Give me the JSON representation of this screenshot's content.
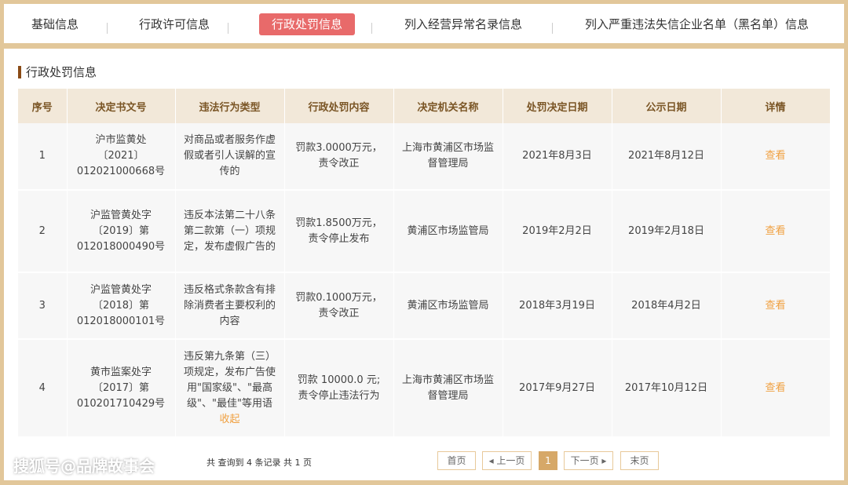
{
  "tabs": [
    {
      "label": "基础信息"
    },
    {
      "label": "行政许可信息"
    },
    {
      "label": "行政处罚信息"
    },
    {
      "label": "列入经营异常名录信息"
    },
    {
      "label": "列入严重违法失信企业名单（黑名单）信息"
    }
  ],
  "section_title": "行政处罚信息",
  "table": {
    "headers": [
      "序号",
      "决定书文号",
      "违法行为类型",
      "行政处罚内容",
      "决定机关名称",
      "处罚决定日期",
      "公示日期",
      "详情"
    ],
    "rows": [
      {
        "no": "1",
        "doc": "沪市监黄处〔2021〕012021000668号",
        "type": "对商品或者服务作虚假或者引人误解的宣传的",
        "content": "罚款3.0000万元，责令改正",
        "org": "上海市黄浦区市场监督管理局",
        "decision_date": "2021年8月3日",
        "publish_date": "2021年8月12日",
        "detail": "查看"
      },
      {
        "no": "2",
        "doc": "沪监管黄处字〔2019〕第012018000490号",
        "type": "违反本法第二十八条第二款第（一）项规定，发布虚假广告的",
        "content": "罚款1.8500万元，责令停止发布",
        "org": "黄浦区市场监管局",
        "decision_date": "2019年2月2日",
        "publish_date": "2019年2月18日",
        "detail": "查看"
      },
      {
        "no": "3",
        "doc": "沪监管黄处字〔2018〕第012018000101号",
        "type": "违反格式条款含有排除消费者主要权利的内容",
        "content": "罚款0.1000万元，责令改正",
        "org": "黄浦区市场监管局",
        "decision_date": "2018年3月19日",
        "publish_date": "2018年4月2日",
        "detail": "查看"
      },
      {
        "no": "4",
        "doc": "黄市监案处字〔2017〕第010201710429号",
        "type": "违反第九条第（三）项规定，发布广告使用\"国家级\"、\"最高级\"、\"最佳\"等用语",
        "collapse": "收起",
        "content": "罚款 10000.0 元;责令停止违法行为",
        "org": "上海市黄浦区市场监督管理局",
        "decision_date": "2017年9月27日",
        "publish_date": "2017年10月12日",
        "detail": "查看"
      }
    ]
  },
  "pagination": {
    "summary": "共 查询到 4 条记录 共 1 页",
    "first": "首页",
    "prev": "◂ 上一页",
    "current": "1",
    "next": "下一页 ▸",
    "last": "末页"
  },
  "watermark": "搜狐号@品牌故事会",
  "colors": {
    "border": "#e2c79a",
    "active_tab": "#e86a6a",
    "header_bg": "#f2e8d9",
    "link": "#f0a040"
  }
}
